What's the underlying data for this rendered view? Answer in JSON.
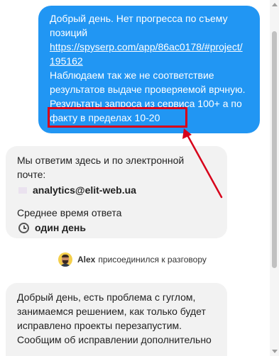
{
  "user_message": {
    "lines": [
      "Добрый день. Нет прогресса по съему",
      "позиций"
    ],
    "link_lines": [
      "https://spyserp.com/app/86ac0178/#project/",
      "195162"
    ],
    "more_lines": [
      "Наблюдаем так же не соответствие",
      "результатов выдаче проверяемой врчную.",
      "Результаты запроса из сервиса 100+ а по",
      "факту в пределах 10-20"
    ]
  },
  "bot_message": {
    "line1": "Мы ответим здесь и по электронной",
    "line2": "почте:",
    "email": "analytics@elit-web.ua",
    "avg_label": "Среднее время ответа",
    "avg_value": "один день"
  },
  "join_notice": {
    "agent_name": "Alex",
    "text": "присоединился к разговору"
  },
  "agent_message": {
    "lines": [
      "Добрый день, есть проблема с гуглом,",
      "занимаемся решением, как только будет",
      "исправлено проекты перезапустим.",
      "Сообщим об исправлении дополнительно"
    ]
  },
  "colors": {
    "user_bubble": "#2196f3",
    "bot_bubble": "#f2f2f2",
    "annotation": "#d7001a"
  }
}
